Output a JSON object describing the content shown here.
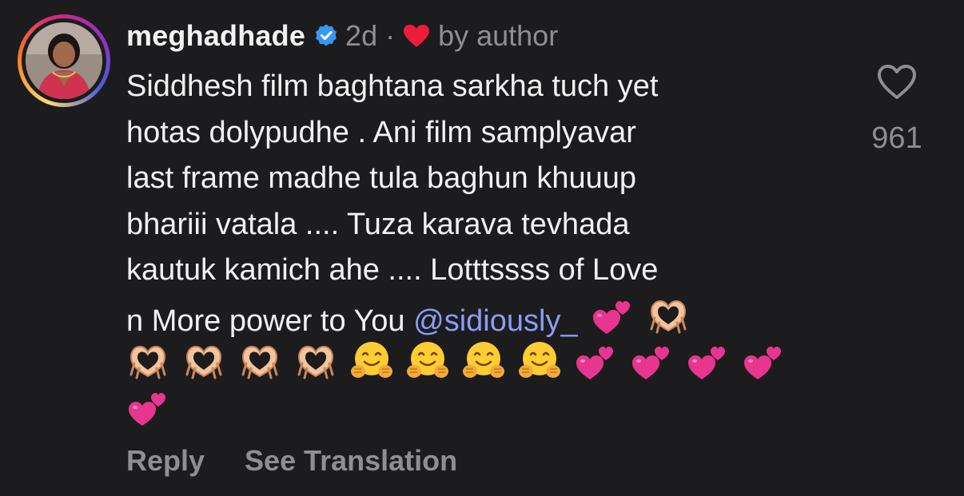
{
  "comment": {
    "username": "meghadhade",
    "time": "2d",
    "separator": "·",
    "by_author": "by author",
    "text_lines": [
      "Siddhesh film baghtana sarkha tuch yet",
      "hotas dolypudhe . Ani film samplyavar",
      "last frame madhe tula baghun khuuup",
      "bhariii vatala .... Tuza karava tevhada",
      "kautuk kamich ahe .... Lotttssss of Love"
    ],
    "last_line_prefix": "n More power to You ",
    "mention": "@sidiously_",
    "emoji_rows": [
      [
        "two-hearts",
        "heart-hands"
      ],
      [
        "heart-hands",
        "heart-hands",
        "heart-hands",
        "heart-hands",
        "hugging-face",
        "hugging-face",
        "hugging-face",
        "hugging-face",
        "two-hearts",
        "two-hearts",
        "two-hearts",
        "two-hearts"
      ],
      [
        "two-hearts"
      ]
    ],
    "likes": "961",
    "reply_label": "Reply",
    "translate_label": "See Translation"
  },
  "colors": {
    "background": "#1c1c1e",
    "text": "#f2f2f2",
    "muted": "#8e8e93",
    "mention": "#8c9cf7",
    "verified": "#3897f0",
    "heart": "#ed1c3c"
  },
  "icons": {
    "verified": "verified-badge-icon",
    "author_heart": "heart-filled-icon",
    "like": "heart-outline-icon"
  }
}
